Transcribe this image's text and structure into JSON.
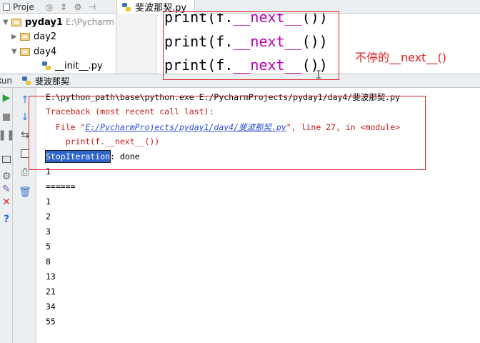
{
  "top_bar": {
    "project_tab": "Proje",
    "editor_tab": "斐波那契.py"
  },
  "tree": {
    "root_label": "pyday1",
    "root_path": "E:\\Pycharm",
    "items": [
      {
        "label": "day2"
      },
      {
        "label": "day4"
      },
      {
        "label": "__init__.py"
      }
    ]
  },
  "editor": {
    "lines": [
      {
        "prefix": "print(f.",
        "dunder": "__next__",
        "suffix": "())"
      },
      {
        "prefix": "print(f.",
        "dunder": "__next__",
        "suffix": "())"
      },
      {
        "prefix": "print(f.",
        "dunder": "__next__",
        "suffix": "())"
      }
    ],
    "annotation": "不停的__next__()"
  },
  "run_bar": {
    "label": "Run",
    "config_name": "斐波那契"
  },
  "console": {
    "command": "E:\\python_path\\base\\python.exe E:/PycharmProjects/pyday1/day4/斐波那契.py",
    "traceback_header": "Traceback (most recent call last):",
    "file_prefix": "  File \"",
    "file_link": "E:/PycharmProjects/pyday1/day4/斐波那契.py",
    "file_suffix": "\", line 27, in <module>",
    "code_line": "    print(f.__next__())",
    "exception_name": "StopIteration",
    "exception_rest": ": done",
    "output": [
      "1",
      "======",
      "1",
      "2",
      "3",
      "5",
      "8",
      "13",
      "21",
      "34",
      "55"
    ]
  },
  "colors": {
    "annotation_red": "#e02020",
    "error_red": "#c41a16",
    "link_blue": "#2a4cd8",
    "selection_blue": "#2f65ca"
  }
}
